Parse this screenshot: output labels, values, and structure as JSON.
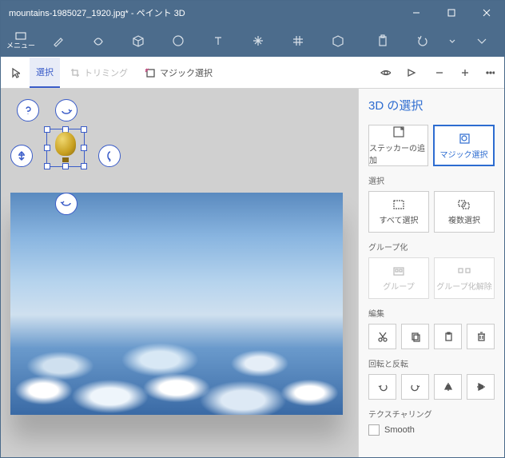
{
  "titlebar": {
    "title": "mountains-1985027_1920.jpg* - ペイント 3D"
  },
  "menu": {
    "label": "メニュー"
  },
  "toolbar": {
    "select": "選択",
    "trimming": "トリミング",
    "magic_select": "マジック選択"
  },
  "sidebar": {
    "title": "3D の選択",
    "add_sticker": "ステッカーの追加",
    "magic_select": "マジック選択",
    "section_select": "選択",
    "select_all": "すべて選択",
    "multi_select": "複数選択",
    "section_group": "グループ化",
    "group": "グループ",
    "ungroup": "グループ化解除",
    "section_edit": "編集",
    "section_rotate": "回転と反転",
    "section_texture": "テクスチャリング",
    "smooth": "Smooth"
  }
}
